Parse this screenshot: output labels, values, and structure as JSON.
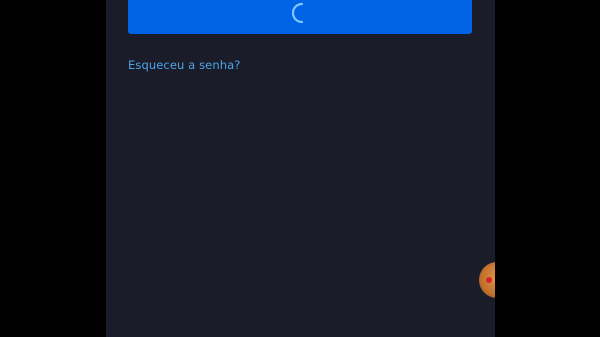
{
  "app": {
    "background_color": "#000000",
    "screen_color": "#1a1d29"
  },
  "login": {
    "button_state": "loading",
    "button_color": "#0063e5",
    "spinner_icon": "loading-spinner-icon"
  },
  "links": {
    "forgot_password": "Esqueceu a senha?"
  },
  "overlay": {
    "bubble_icon": "floating-assistant-bubble-icon",
    "bubble_color": "#d48539"
  }
}
